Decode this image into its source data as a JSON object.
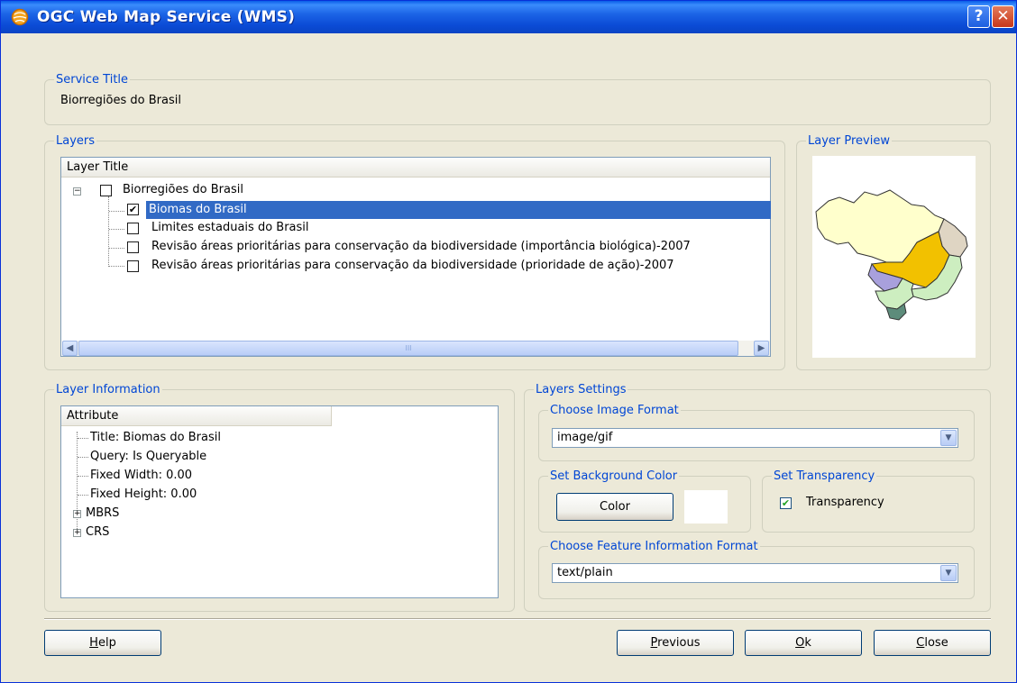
{
  "window": {
    "title": "OGC Web Map Service (WMS)",
    "help_glyph": "?",
    "close_glyph": "✕"
  },
  "service": {
    "legend": "Service Title",
    "value": "Biorregiões do Brasil"
  },
  "layers": {
    "legend": "Layers",
    "column": "Layer Title",
    "root": "Biorregiões do Brasil",
    "items": [
      {
        "label": "Biomas do Brasil",
        "checked": true,
        "selected": true
      },
      {
        "label": "Limites estaduais do Brasil",
        "checked": false
      },
      {
        "label": "Revisão áreas prioritárias para conservação da biodiversidade (importância biológica)-2007",
        "checked": false
      },
      {
        "label": "Revisão áreas prioritárias para conservação da biodiversidade (prioridade de ação)-2007",
        "checked": false
      }
    ],
    "scroll_grip": "III"
  },
  "preview": {
    "legend": "Layer Preview"
  },
  "info": {
    "legend": "Layer Information",
    "column": "Attribute",
    "rows": [
      "Title: Biomas do Brasil",
      "Query: Is Queryable",
      "Fixed Width: 0.00",
      "Fixed Height: 0.00"
    ],
    "groups": [
      "MBRS",
      "CRS"
    ]
  },
  "settings": {
    "legend": "Layers Settings",
    "image_format": {
      "legend": "Choose Image Format",
      "value": "image/gif"
    },
    "background": {
      "legend": "Set Background Color",
      "button": "Color",
      "color": "#ffffff"
    },
    "transparency": {
      "legend": "Set Transparency",
      "label": "Transparency",
      "checked": true
    },
    "feature_format": {
      "legend": "Choose Feature Information Format",
      "value": "text/plain"
    }
  },
  "buttons": {
    "help": {
      "u": "H",
      "rest": "elp"
    },
    "previous": {
      "u": "P",
      "rest": "revious"
    },
    "ok": {
      "u": "O",
      "rest": "k"
    },
    "close": {
      "u": "C",
      "rest": "lose"
    }
  },
  "colors": {
    "accent": "#0046d5",
    "selection": "#316ac5",
    "titlebar": "#0b4bd6"
  }
}
